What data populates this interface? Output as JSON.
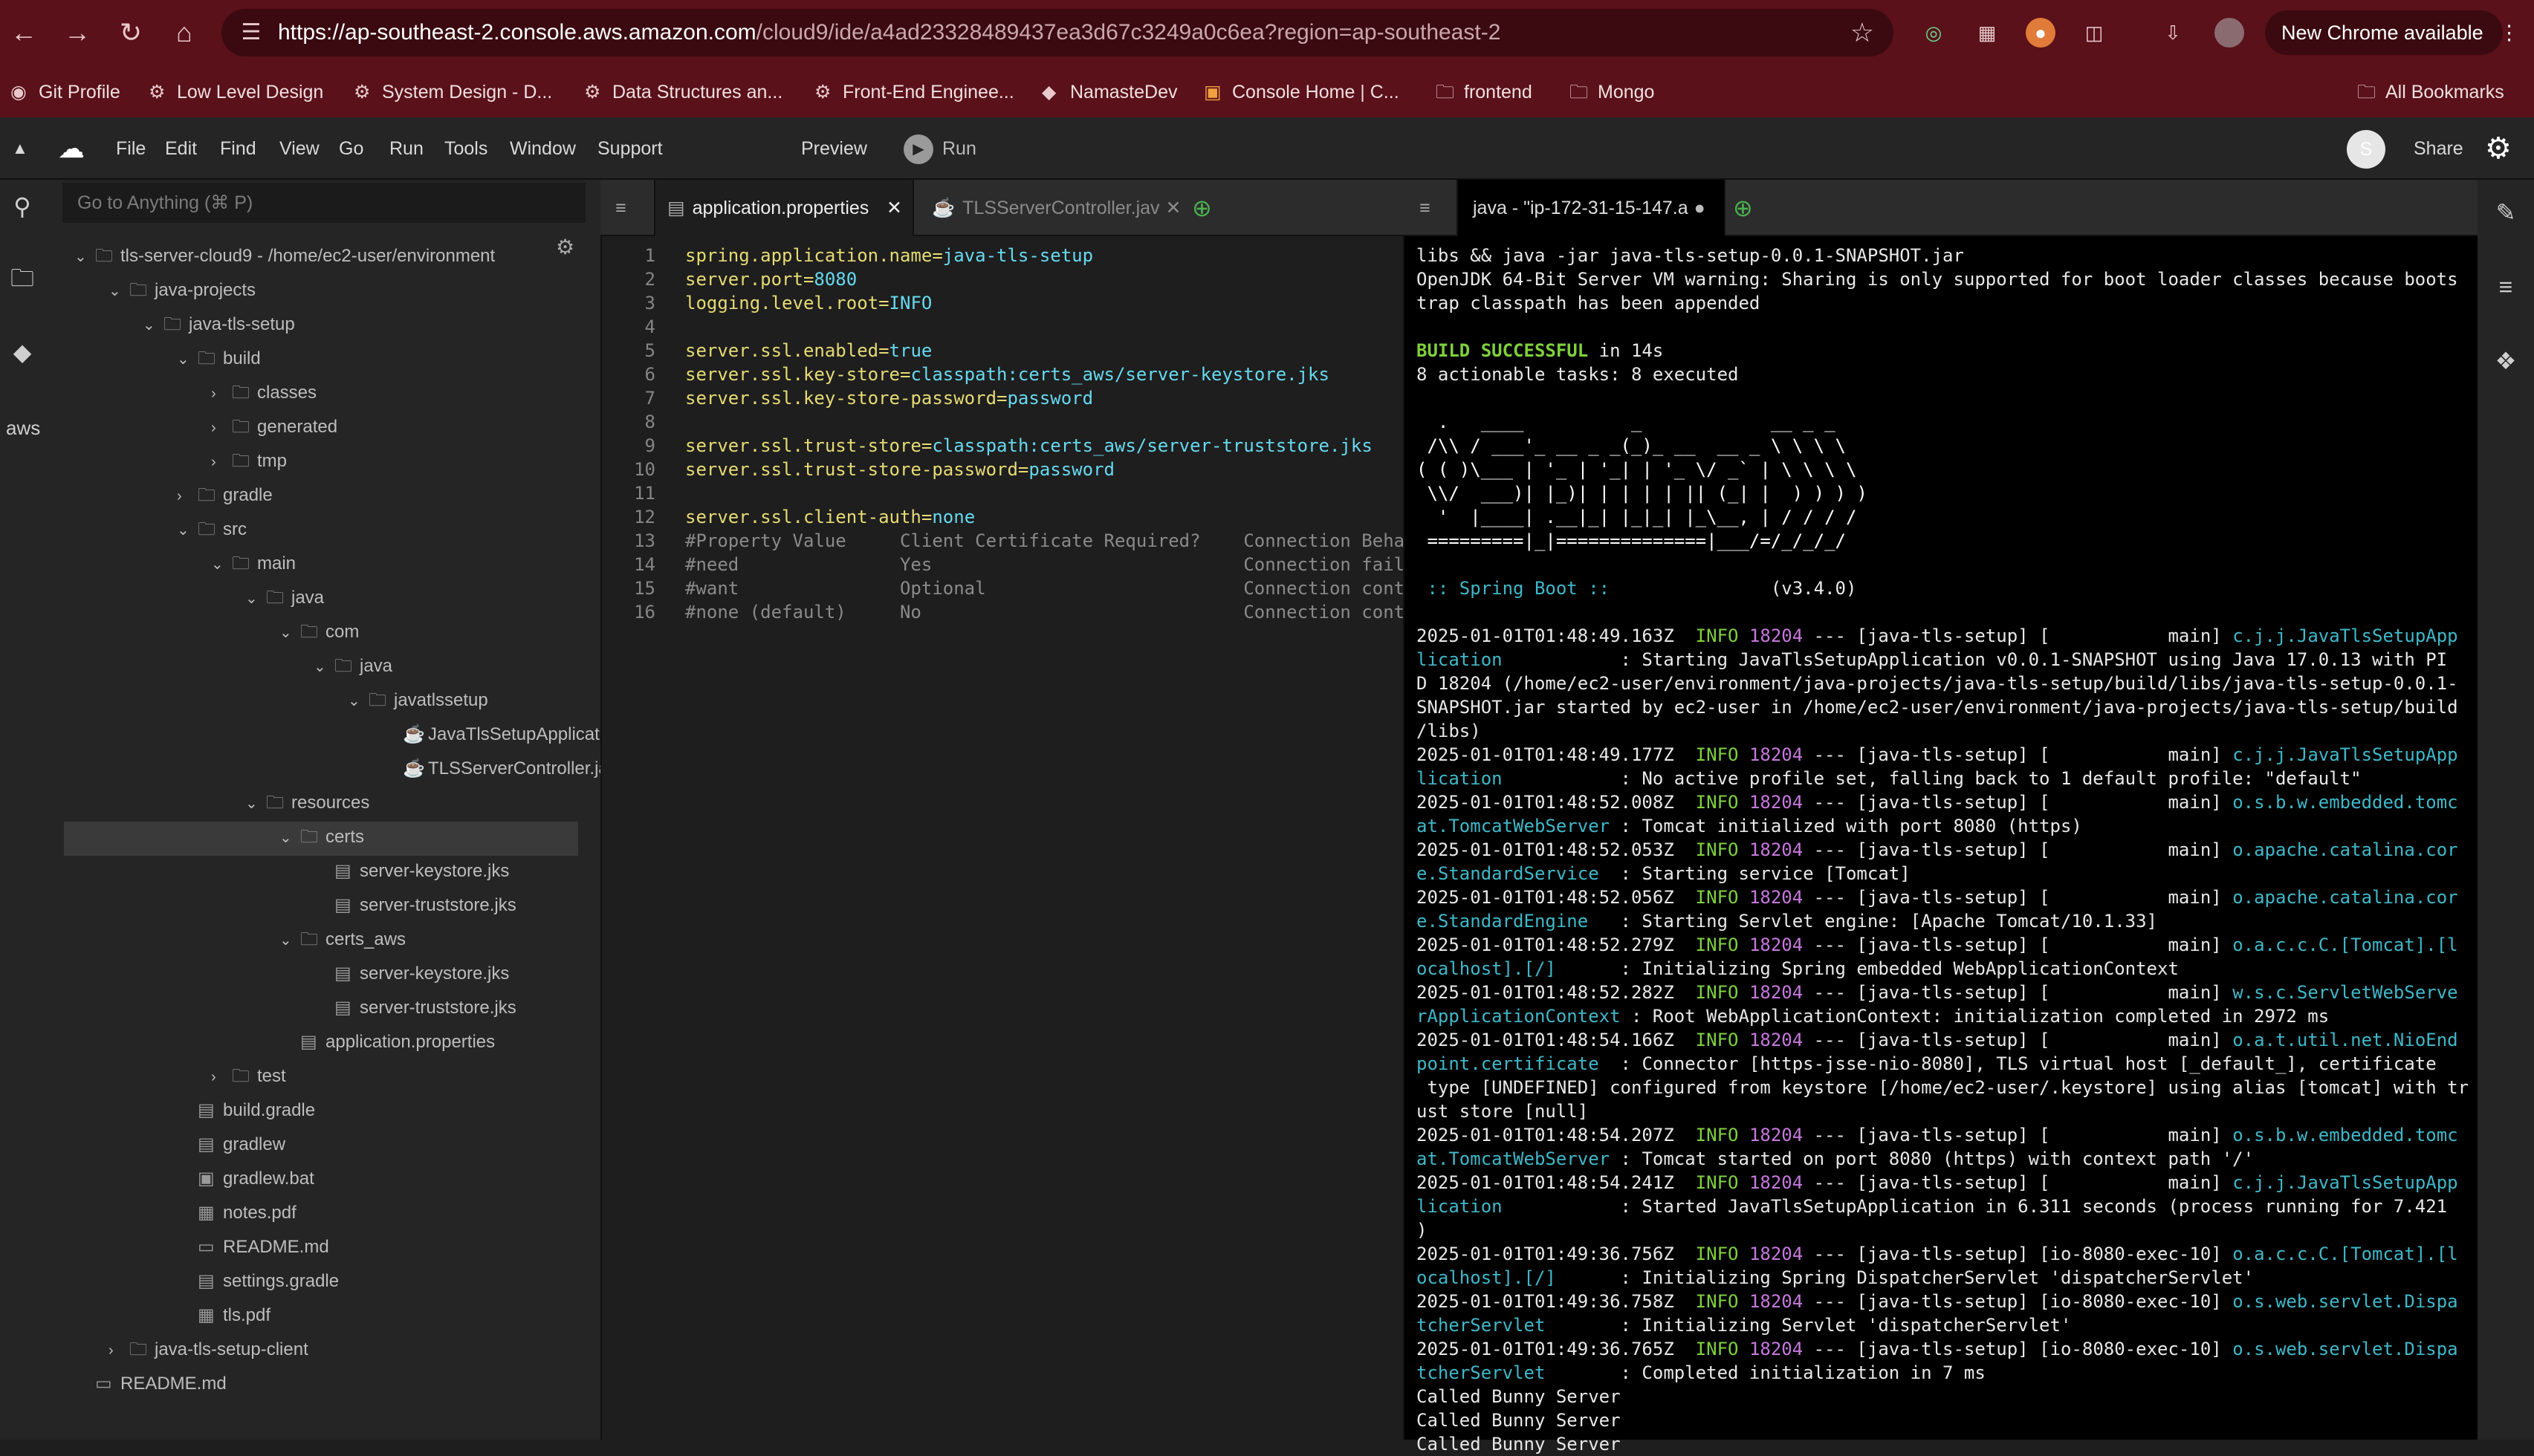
{
  "browser": {
    "url_host": "https://ap-southeast-2.console.aws.amazon.com",
    "url_path": "/cloud9/ide/a4ad23328489437ea3d67c3249a0c6ea?region=ap-southeast-2",
    "new_chrome_label": "New Chrome available",
    "bookmarks": [
      "Git Profile",
      "Low Level Design",
      "System Design - D...",
      "Data Structures an...",
      "Front-End Enginee...",
      "NamasteDev",
      "Console Home | C...",
      "frontend",
      "Mongo"
    ],
    "all_bookmarks": "All Bookmarks"
  },
  "menu": {
    "items": [
      "File",
      "Edit",
      "Find",
      "View",
      "Go",
      "Run",
      "Tools",
      "Window",
      "Support"
    ],
    "preview": "Preview",
    "run": "Run",
    "share": "Share",
    "avatar_letter": "S"
  },
  "explorer": {
    "goto_placeholder": "Go to Anything (⌘ P)",
    "tree": [
      "tls-server-cloud9 - /home/ec2-user/environment",
      "java-projects",
      "java-tls-setup",
      "build",
      "classes",
      "generated",
      "tmp",
      "gradle",
      "src",
      "main",
      "java",
      "com",
      "java",
      "javatlssetup",
      "JavaTlsSetupApplication.java",
      "TLSServerController.java",
      "resources",
      "certs",
      "server-keystore.jks",
      "server-truststore.jks",
      "certs_aws",
      "server-keystore.jks",
      "server-truststore.jks",
      "application.properties",
      "test",
      "build.gradle",
      "gradlew",
      "gradlew.bat",
      "notes.pdf",
      "README.md",
      "settings.gradle",
      "tls.pdf",
      "java-tls-setup-client",
      "README.md"
    ]
  },
  "editor": {
    "tabs": [
      "application.properties",
      "TLSServerController.jav"
    ],
    "lines": [
      {
        "k": "spring.application.name=",
        "v": "java-tls-setup"
      },
      {
        "k": "server.port=",
        "v": "8080"
      },
      {
        "k": "logging.level.root=",
        "v": "INFO"
      },
      {
        "k": "",
        "v": ""
      },
      {
        "k": "server.ssl.enabled=",
        "v": "true"
      },
      {
        "k": "server.ssl.key-store=",
        "v": "classpath:certs_aws/server-keystore.jks"
      },
      {
        "k": "server.ssl.key-store-password=",
        "v": "password"
      },
      {
        "k": "",
        "v": ""
      },
      {
        "k": "server.ssl.trust-store=",
        "v": "classpath:certs_aws/server-truststore.jks"
      },
      {
        "k": "server.ssl.trust-store-password=",
        "v": "password"
      },
      {
        "k": "",
        "v": ""
      },
      {
        "k": "server.ssl.client-auth=",
        "v": "none"
      },
      {
        "c": "#Property Value     Client Certificate Required?    Connection Beha"
      },
      {
        "c": "#need               Yes                             Connection fail"
      },
      {
        "c": "#want               Optional                        Connection cont"
      },
      {
        "c": "#none (default)     No                              Connection cont"
      }
    ]
  },
  "terminal": {
    "tab": "java - \"ip-172-31-15-147.a",
    "lines": [
      {
        "t": "libs && java -jar java-tls-setup-0.0.1-SNAPSHOT.jar"
      },
      {
        "t": "OpenJDK 64-Bit Server VM warning: Sharing is only supported for boot loader classes because boots"
      },
      {
        "t": "trap classpath has been appended"
      },
      {
        "t": ""
      },
      {
        "g": "BUILD SUCCESSFUL",
        "t": " in 14s"
      },
      {
        "t": "8 actionable tasks: 8 executed"
      },
      {
        "t": ""
      },
      {
        "b": "  .   ____          _            __ _ _"
      },
      {
        "b": " /\\\\ / ___'_ __ _ _(_)_ __  __ _ \\ \\ \\ \\"
      },
      {
        "b": "( ( )\\___ | '_ | '_| | '_ \\/ _` | \\ \\ \\ \\"
      },
      {
        "b": " \\\\/  ___)| |_)| | | | | || (_| |  ) ) ) )"
      },
      {
        "b": "  '  |____| .__|_| |_|_| |_\\__, | / / / /"
      },
      {
        "b": " =========|_|==============|___/=/_/_/_/"
      },
      {
        "t": ""
      },
      {
        "sb": " :: Spring Boot ::",
        "t": "               (v3.4.0)"
      },
      {
        "t": ""
      },
      {
        "ts": "2025-01-01T01:48:49.163Z",
        "th": "18204",
        "tt": "main",
        "cl": "c.j.j.JavaTlsSetupApp"
      },
      {
        "cl2": "lication",
        "t": "           : Starting JavaTlsSetupApplication v0.0.1-SNAPSHOT using Java 17.0.13 with PI"
      },
      {
        "t": "D 18204 (/home/ec2-user/environment/java-projects/java-tls-setup/build/libs/java-tls-setup-0.0.1-"
      },
      {
        "t": "SNAPSHOT.jar started by ec2-user in /home/ec2-user/environment/java-projects/java-tls-setup/build"
      },
      {
        "t": "/libs)"
      },
      {
        "ts": "2025-01-01T01:48:49.177Z",
        "th": "18204",
        "tt": "main",
        "cl": "c.j.j.JavaTlsSetupApp"
      },
      {
        "cl2": "lication",
        "t": "           : No active profile set, falling back to 1 default profile: \"default\""
      },
      {
        "ts": "2025-01-01T01:48:52.008Z",
        "th": "18204",
        "tt": "main",
        "cl": "o.s.b.w.embedded.tomc"
      },
      {
        "cl2": "at.TomcatWebServer",
        "t": " : Tomcat initialized with port 8080 (https)"
      },
      {
        "ts": "2025-01-01T01:48:52.053Z",
        "th": "18204",
        "tt": "main",
        "cl": "o.apache.catalina.cor"
      },
      {
        "cl2": "e.StandardService",
        "t": "  : Starting service [Tomcat]"
      },
      {
        "ts": "2025-01-01T01:48:52.056Z",
        "th": "18204",
        "tt": "main",
        "cl": "o.apache.catalina.cor"
      },
      {
        "cl2": "e.StandardEngine",
        "t": "   : Starting Servlet engine: [Apache Tomcat/10.1.33]"
      },
      {
        "ts": "2025-01-01T01:48:52.279Z",
        "th": "18204",
        "tt": "main",
        "cl": "o.a.c.c.C.[Tomcat].[l"
      },
      {
        "cl2": "ocalhost].[/]",
        "t": "      : Initializing Spring embedded WebApplicationContext"
      },
      {
        "ts": "2025-01-01T01:48:52.282Z",
        "th": "18204",
        "tt": "main",
        "cl": "w.s.c.ServletWebServe"
      },
      {
        "cl2": "rApplicationContext",
        "t": " : Root WebApplicationContext: initialization completed in 2972 ms"
      },
      {
        "ts": "2025-01-01T01:48:54.166Z",
        "th": "18204",
        "tt": "main",
        "cl": "o.a.t.util.net.NioEnd"
      },
      {
        "cl2": "point.certificate",
        "t": "  : Connector [https-jsse-nio-8080], TLS virtual host [_default_], certificate"
      },
      {
        "t": " type [UNDEFINED] configured from keystore [/home/ec2-user/.keystore] using alias [tomcat] with tr"
      },
      {
        "t": "ust store [null]"
      },
      {
        "ts": "2025-01-01T01:48:54.207Z",
        "th": "18204",
        "tt": "main",
        "cl": "o.s.b.w.embedded.tomc"
      },
      {
        "cl2": "at.TomcatWebServer",
        "t": " : Tomcat started on port 8080 (https) with context path '/'"
      },
      {
        "ts": "2025-01-01T01:48:54.241Z",
        "th": "18204",
        "tt": "main",
        "cl": "c.j.j.JavaTlsSetupApp"
      },
      {
        "cl2": "lication",
        "t": "           : Started JavaTlsSetupApplication in 6.311 seconds (process running for 7.421"
      },
      {
        "t": ")"
      },
      {
        "ts": "2025-01-01T01:49:36.756Z",
        "th": "18204",
        "tt": "io-8080-exec-10",
        "cl": "o.a.c.c.C.[Tomcat].[l"
      },
      {
        "cl2": "ocalhost].[/]",
        "t": "      : Initializing Spring DispatcherServlet 'dispatcherServlet'"
      },
      {
        "ts": "2025-01-01T01:49:36.758Z",
        "th": "18204",
        "tt": "io-8080-exec-10",
        "cl": "o.s.web.servlet.Dispa"
      },
      {
        "cl2": "tcherServlet",
        "t": "       : Initializing Servlet 'dispatcherServlet'"
      },
      {
        "ts": "2025-01-01T01:49:36.765Z",
        "th": "18204",
        "tt": "io-8080-exec-10",
        "cl": "o.s.web.servlet.Dispa"
      },
      {
        "cl2": "tcherServlet",
        "t": "       : Completed initialization in 7 ms"
      },
      {
        "t": "Called Bunny Server"
      },
      {
        "t": "Called Bunny Server"
      },
      {
        "t": "Called Bunny Server"
      }
    ]
  }
}
